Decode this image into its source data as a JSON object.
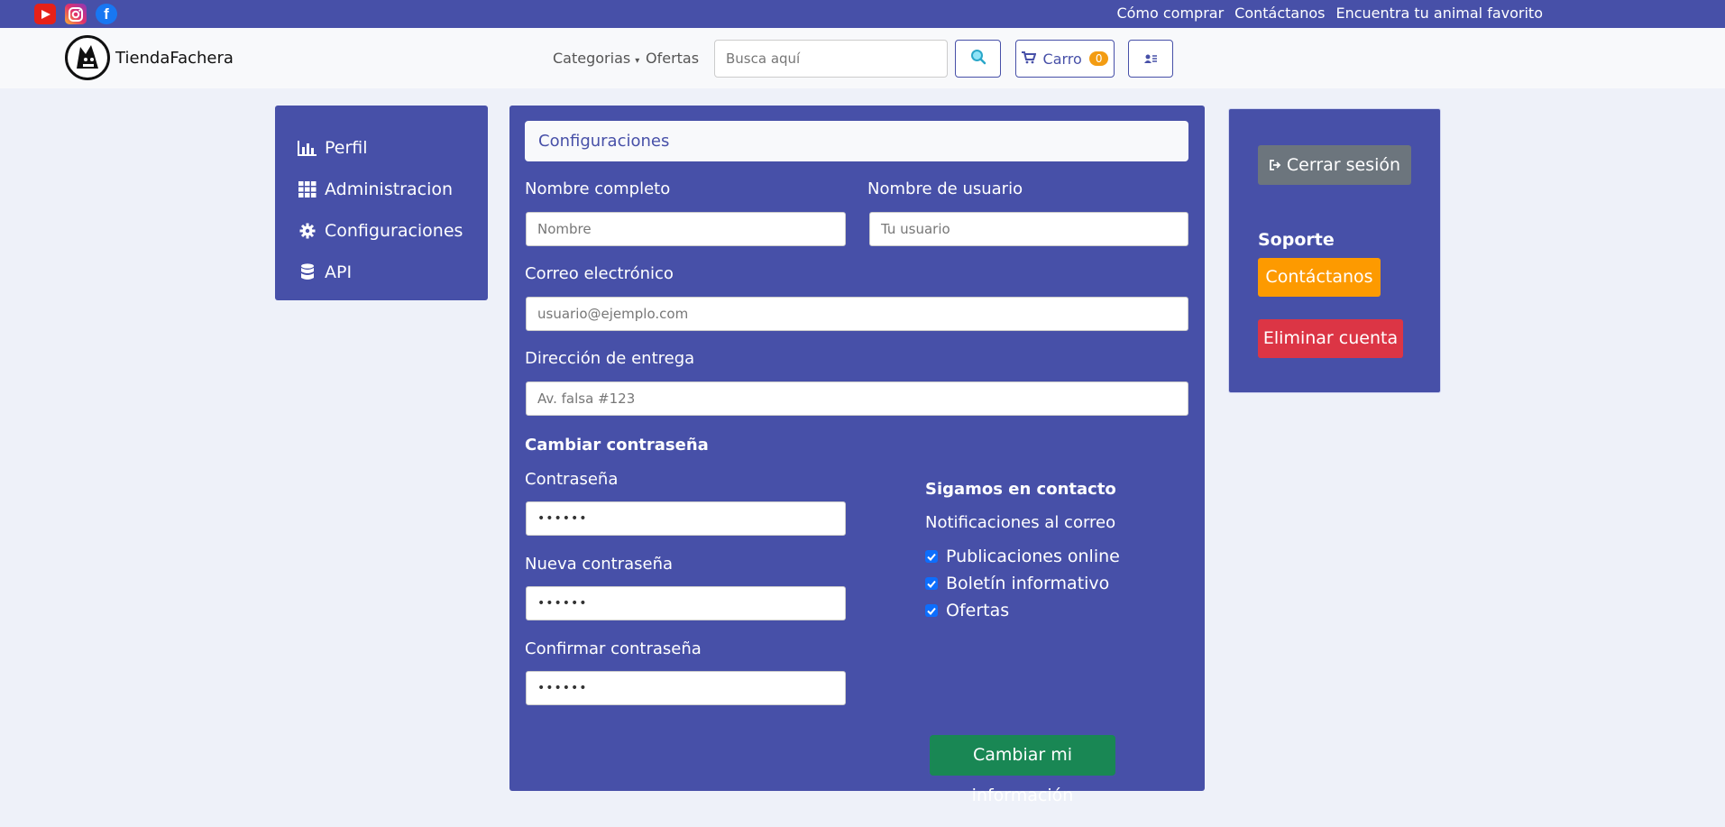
{
  "topbar": {
    "social": [
      "youtube-icon",
      "instagram-icon",
      "facebook-icon"
    ],
    "links": [
      "Cómo comprar",
      "Contáctanos",
      "Encuentra tu animal favorito"
    ]
  },
  "navbar": {
    "brand": "TiendaFachera",
    "categories": "Categorias",
    "offers": "Ofertas",
    "search_placeholder": "Busca aquí",
    "cart_label": "Carro",
    "cart_count": "0"
  },
  "sidebar": {
    "items": [
      {
        "label": "Perfil",
        "icon": "bar-chart-icon"
      },
      {
        "label": "Administracion",
        "icon": "grid-icon"
      },
      {
        "label": "Configuraciones",
        "icon": "gear-icon"
      },
      {
        "label": "API",
        "icon": "database-icon"
      }
    ]
  },
  "form": {
    "title": "Configuraciones",
    "full_name_label": "Nombre completo",
    "full_name_placeholder": "Nombre",
    "username_label": "Nombre de usuario",
    "username_placeholder": "Tu usuario",
    "email_label": "Correo electrónico",
    "email_placeholder": "usuario@ejemplo.com",
    "address_label": "Dirección de entrega",
    "address_placeholder": "Av. falsa #123",
    "change_password_heading": "Cambiar contraseña",
    "password_label": "Contraseña",
    "password_value": "••••••",
    "new_password_label": "Nueva contraseña",
    "new_password_value": "••••••",
    "confirm_password_label": "Confirmar contraseña",
    "confirm_password_value": "••••••",
    "contact_heading": "Sigamos en contacto",
    "notifications_label": "Notificaciones al correo",
    "checkboxes": [
      "Publicaciones online",
      "Boletín informativo",
      "Ofertas"
    ],
    "submit_label": "Cambiar mi información"
  },
  "right": {
    "logout_label": "Cerrar sesión",
    "support_heading": "Soporte",
    "contact_label": "Contáctanos",
    "delete_label": "Eliminar cuenta"
  },
  "colors": {
    "primary": "#4750a8",
    "success": "#198754",
    "warning": "#fd9a00",
    "danger": "#dc3545",
    "secondary": "#6c757d"
  }
}
